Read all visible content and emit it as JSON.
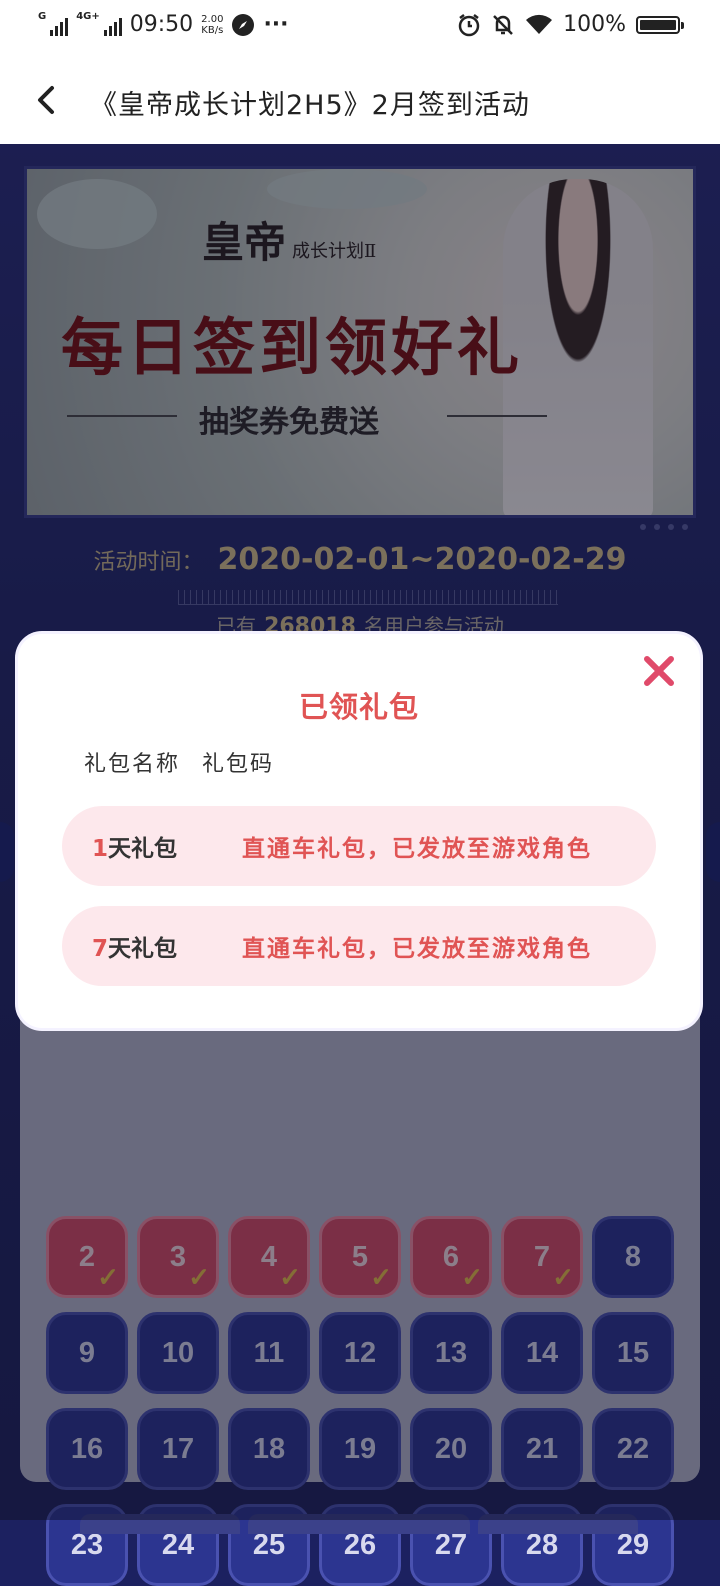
{
  "status_bar": {
    "network_type": "G",
    "network_type_2": "4G+",
    "time": "09:50",
    "speed_value": "2.00",
    "speed_unit": "KB/s",
    "more": "···",
    "battery": "100%"
  },
  "nav": {
    "title": "《皇帝成长计划2H5》2月签到活动"
  },
  "banner": {
    "logo": "皇帝",
    "logo_sub": "成长计划Ⅱ",
    "headline": "每日签到领好礼",
    "subline": "抽奖券免费送"
  },
  "activity": {
    "time_label": "活动时间：",
    "time_range": "2020-02-01~2020-02-29",
    "participants_prefix": "已有",
    "participants_count": "268018",
    "participants_suffix": "名用户参与活动"
  },
  "calendar": {
    "signed_days": [
      "2",
      "3",
      "4",
      "5",
      "6",
      "7"
    ],
    "rows": [
      [
        "2",
        "3",
        "4",
        "5",
        "6",
        "7",
        "8"
      ],
      [
        "9",
        "10",
        "11",
        "12",
        "13",
        "14",
        "15"
      ],
      [
        "16",
        "17",
        "18",
        "19",
        "20",
        "21",
        "22"
      ],
      [
        "23",
        "24",
        "25",
        "26",
        "27",
        "28",
        "29"
      ]
    ]
  },
  "modal": {
    "title": "已领礼包",
    "col_name": "礼包名称",
    "col_code": "礼包码",
    "gifts": [
      {
        "day": "1",
        "suffix": "天礼包",
        "code": "直通车礼包，已发放至游戏角色"
      },
      {
        "day": "7",
        "suffix": "天礼包",
        "code": "直通车礼包，已发放至游戏角色"
      }
    ]
  },
  "colors": {
    "accent_red": "#e05454",
    "gold": "#d8c38c",
    "navy": "#2c3590"
  }
}
